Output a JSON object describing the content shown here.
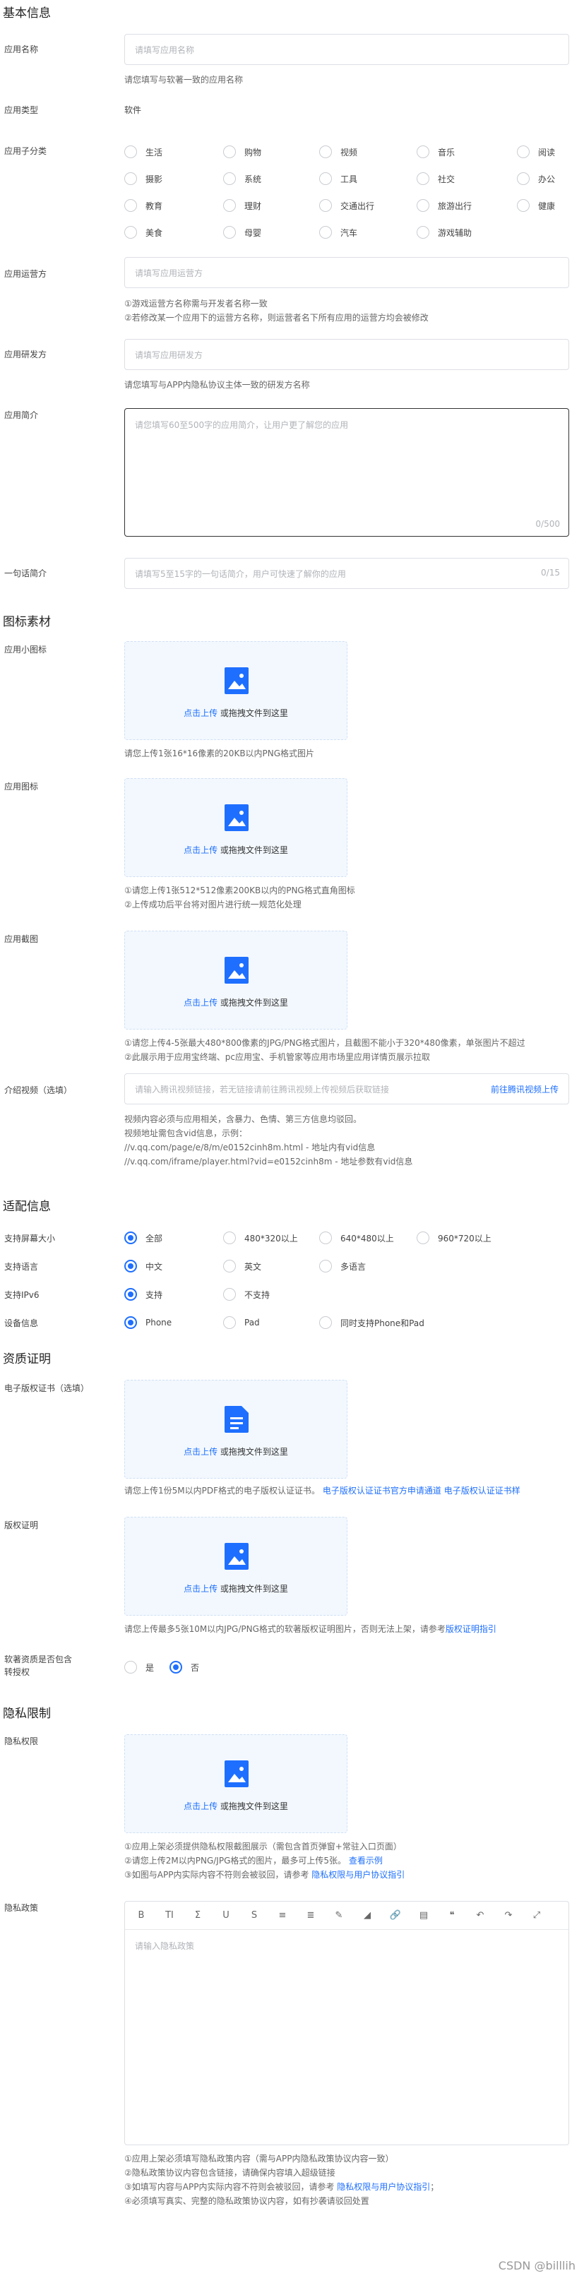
{
  "basic": {
    "title": "基本信息",
    "app_name": {
      "label": "应用名称",
      "placeholder": "请填写应用名称",
      "hint": "请您填写与软著一致的应用名称"
    },
    "app_type": {
      "label": "应用类型",
      "value": "软件"
    },
    "app_subcategory": {
      "label": "应用子分类",
      "options": [
        "生活",
        "购物",
        "视频",
        "音乐",
        "阅读",
        "摄影",
        "系统",
        "工具",
        "社交",
        "办公",
        "教育",
        "理财",
        "交通出行",
        "旅游出行",
        "健康",
        "美食",
        "母婴",
        "汽车",
        "游戏辅助"
      ]
    },
    "operator": {
      "label": "应用运营方",
      "placeholder": "请填写应用运营方",
      "hint1": "①游戏运营方名称需与开发者名称一致",
      "hint2": "②若修改某一个应用下的运营方名称，则运营者名下所有应用的运营方均会被修改"
    },
    "developer": {
      "label": "应用研发方",
      "placeholder": "请填写应用研发方",
      "hint": "请您填写与APP内隐私协议主体一致的研发方名称"
    },
    "intro": {
      "label": "应用简介",
      "placeholder": "请您填写60至500字的应用简介，让用户更了解您的应用",
      "count": "0/500"
    },
    "brief": {
      "label": "一句话简介",
      "placeholder": "请填写5至15字的一句话简介，用户可快速了解你的应用",
      "count": "0/15"
    }
  },
  "icons": {
    "title": "图标素材",
    "upload_link": "点击上传",
    "upload_tail": "或拖拽文件到这里",
    "small_icon": {
      "label": "应用小图标",
      "hint": "请您上传1张16*16像素的20KB以内PNG格式图片"
    },
    "app_icon": {
      "label": "应用图标",
      "hint1": "①请您上传1张512*512像素200KB以内的PNG格式直角图标",
      "hint2": "②上传成功后平台将对图片进行统一规范化处理"
    },
    "screenshots": {
      "label": "应用截图",
      "hint1": "①请您上传4-5张最大480*800像素的JPG/PNG格式图片，且截图不能小于320*480像素，单张图片不超过",
      "hint2": "②此展示用于应用宝终端、pc应用宝、手机管家等应用市场里应用详情页展示拉取"
    },
    "video": {
      "label": "介绍视频（选填）",
      "placeholder": "请输入腾讯视频链接，若无链接请前往腾讯视频上传视频后获取链接",
      "link": "前往腾讯视频上传",
      "hint1": "视频内容必须与应用相关，含暴力、色情、第三方信息均驳回。",
      "hint2": "视频地址需包含vid信息，示例：",
      "hint3": "//v.qq.com/page/e/8/m/e0152cinh8m.html - 地址内有vid信息",
      "hint4": "//v.qq.com/iframe/player.html?vid=e0152cinh8m - 地址参数有vid信息"
    }
  },
  "adapt": {
    "title": "适配信息",
    "screen": {
      "label": "支持屏幕大小",
      "options": [
        "全部",
        "480*320以上",
        "640*480以上",
        "960*720以上"
      ],
      "selected": "全部"
    },
    "language": {
      "label": "支持语言",
      "options": [
        "中文",
        "英文",
        "多语言"
      ],
      "selected": "中文"
    },
    "ipv6": {
      "label": "支持IPv6",
      "options": [
        "支持",
        "不支持"
      ],
      "selected": "支持"
    },
    "device": {
      "label": "设备信息",
      "options": [
        "Phone",
        "Pad",
        "同时支持Phone和Pad"
      ],
      "selected": "Phone"
    }
  },
  "qualification": {
    "title": "资质证明",
    "ecopyright": {
      "label": "电子版权证书（选填）",
      "hint_text": "请您上传1份5M以内PDF格式的电子版权认证证书。",
      "link1": "电子版权认证证书官方申请通道",
      "link2": "电子版权认证证书样"
    },
    "copyright": {
      "label": "版权证明",
      "hint_text": "请您上传最多5张10M以内JPG/PNG格式的软著版权证明图片，否则无法上架，请参考",
      "link": "版权证明指引"
    },
    "hardcopy": {
      "label1": "软著资质是否包含",
      "label2": "转授权",
      "options": [
        "是",
        "否"
      ],
      "selected": "否"
    }
  },
  "privacy": {
    "title": "隐私限制",
    "privacy_perm": {
      "label": "隐私权限",
      "hint1": "①应用上架必须提供隐私权限截图展示（需包含首页弹窗+常驻入口页面）",
      "hint2_text": "②请您上传2M以内PNG/JPG格式的图片，最多可上传5张。",
      "hint2_link": "查看示例",
      "hint3_text": "③如图与APP内实际内容不符则会被驳回，请参考",
      "hint3_link": "隐私权限与用户协议指引"
    },
    "policy": {
      "label": "隐私政策",
      "placeholder": "请输入隐私政策",
      "toolbar": [
        "B",
        "TI",
        "Ʃ",
        "U",
        "S",
        "≡",
        "≣",
        "✎",
        "◢",
        "🔗",
        "▤",
        "❝",
        "↶",
        "↷",
        "⤢"
      ],
      "hint1": "①应用上架必须填写隐私政策内容（需与APP内隐私政策协议内容一致）",
      "hint2": "②隐私政策协议内容包含链接，请确保内容填入超级链接",
      "hint3_text": "③如填写内容与APP内实际内容不符则会被驳回，请参考",
      "hint3_link": "隐私权限与用户协议指引",
      "hint3_tail": "；",
      "hint4": "④必须填写真实、完整的隐私政策协议内容，如有抄袭请驳回处置"
    }
  },
  "watermark": "CSDN @billlih",
  "colors": {
    "accent": "#1e6fff"
  }
}
